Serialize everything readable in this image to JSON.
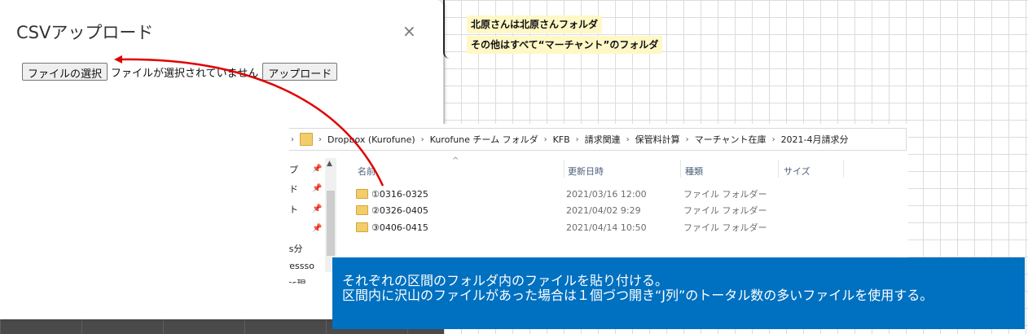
{
  "notes": {
    "line1": "北原さんは北原さんフォルダ",
    "line2": "その他はすべて“マーチャント”のフォルダ"
  },
  "modal": {
    "title": "CSVアップロード",
    "close": "×",
    "choose_file_label": "ファイルの選択",
    "no_file_text": "ファイルが選択されていません",
    "upload_label": "アップロード"
  },
  "explorer": {
    "breadcrumb": [
      "Dropbox (Kurofune)",
      "Kurofune チーム フォルダ",
      "KFB",
      "請求関連",
      "保管料計算",
      "マーチャント在庫",
      "2021-4月請求分"
    ],
    "nav_items": [
      "プ",
      "ド",
      "ト",
      "ss分",
      "ressso",
      "ss現"
    ],
    "columns": [
      "名前",
      "更新日時",
      "種類",
      "サイズ"
    ],
    "rows": [
      {
        "name": "①0316-0325",
        "modified": "2021/03/16 12:00",
        "type": "ファイル フォルダー"
      },
      {
        "name": "②0326-0405",
        "modified": "2021/04/02 9:29",
        "type": "ファイル フォルダー"
      },
      {
        "name": "③0406-0415",
        "modified": "2021/04/14 10:50",
        "type": "ファイル フォルダー"
      }
    ]
  },
  "callout": {
    "line1": "それぞれの区間のフォルダ内のファイルを貼り付ける。",
    "line2": "区間内に沢山のファイルがあった場合は１個づつ開き“J列”のトータル数の多いファイルを使用する。"
  },
  "colors": {
    "note_bg": "#fff8c6",
    "callout_bg": "#0070c0",
    "arrow": "#e00000",
    "folder": "#f3cd6b"
  }
}
